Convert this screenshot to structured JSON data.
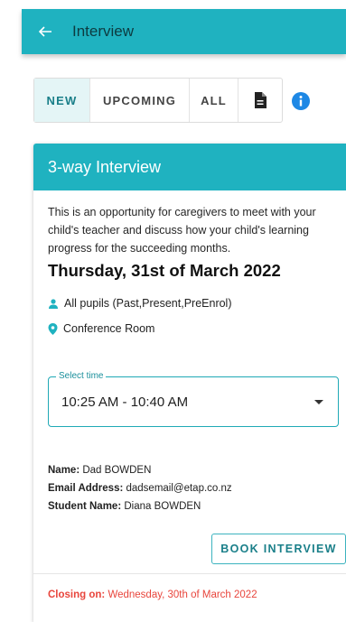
{
  "appbar": {
    "title": "Interview",
    "back_icon": "arrow-left-icon"
  },
  "tabs": [
    {
      "label": "NEW",
      "active": true
    },
    {
      "label": "UPCOMING",
      "active": false
    },
    {
      "label": "ALL",
      "active": false
    }
  ],
  "toolbar": {
    "document_icon": "document-icon",
    "info_icon": "info-icon"
  },
  "card": {
    "title": "3-way Interview",
    "description": "This is an opportunity for caregivers to meet with your child's teacher and discuss how your child's learning progress for the succeeding months.",
    "date": "Thursday, 31st of March 2022",
    "audience": "All pupils (Past,Present,PreEnrol)",
    "location": "Conference Room",
    "select": {
      "legend": "Select time",
      "value": "10:25 AM - 10:40 AM"
    },
    "user": {
      "name_label": "Name:",
      "name": "Dad BOWDEN",
      "email_label": "Email Address:",
      "email": "dadsemail@etap.co.nz",
      "student_label": "Student Name:",
      "student": "Diana BOWDEN"
    },
    "book_button": "BOOK INTERVIEW",
    "closing_label": "Closing on:",
    "closing_date": "Wednesday, 30th of March 2022"
  },
  "colors": {
    "primary": "#1fb2c0",
    "accent_text": "#1a7f89",
    "info": "#1e88e5",
    "danger": "#e8453c"
  }
}
